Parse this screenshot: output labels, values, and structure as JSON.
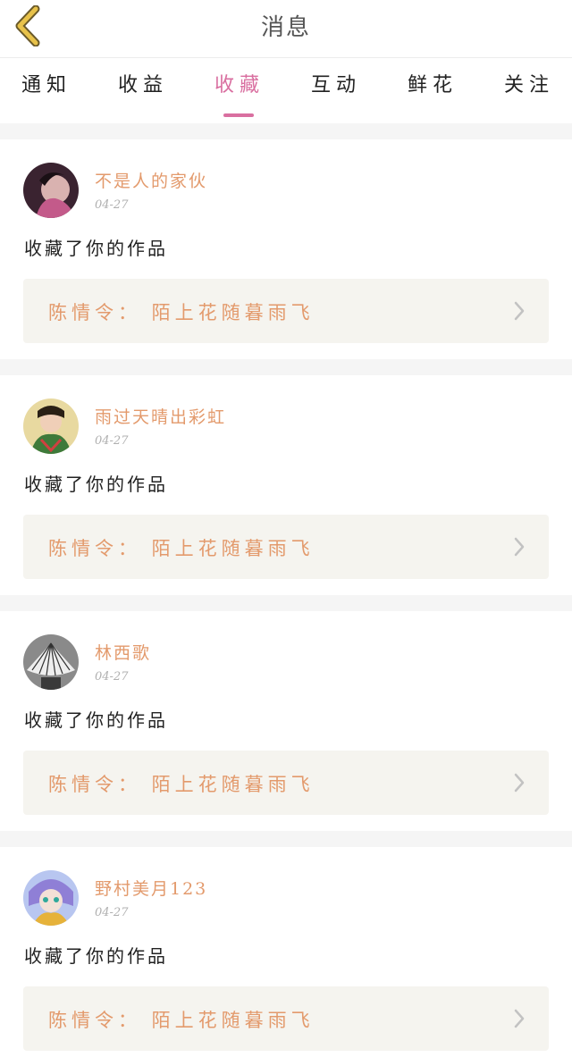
{
  "header": {
    "title": "消息"
  },
  "tabs": [
    {
      "label": "通知",
      "active": false
    },
    {
      "label": "收益",
      "active": false
    },
    {
      "label": "收藏",
      "active": true
    },
    {
      "label": "互动",
      "active": false
    },
    {
      "label": "鲜花",
      "active": false
    },
    {
      "label": "关注",
      "active": false
    }
  ],
  "colors": {
    "accent": "#d96fa0",
    "name": "#e39a6c",
    "box_bg": "#f5f4ef",
    "back_icon": "#e8c24a"
  },
  "icons": {
    "back": "chevron-left-icon",
    "open_work": "chevron-right-icon"
  },
  "messages": [
    {
      "username": "不是人的家伙",
      "date": "04-27",
      "action": "收藏了你的作品",
      "work": "陈情令：  陌上花随暮雨飞"
    },
    {
      "username": "雨过天晴出彩虹",
      "date": "04-27",
      "action": "收藏了你的作品",
      "work": "陈情令：  陌上花随暮雨飞"
    },
    {
      "username": "林西歌",
      "date": "04-27",
      "action": "收藏了你的作品",
      "work": "陈情令：  陌上花随暮雨飞"
    },
    {
      "username": "野村美月123",
      "date": "04-27",
      "action": "收藏了你的作品",
      "work": "陈情令：  陌上花随暮雨飞"
    }
  ]
}
